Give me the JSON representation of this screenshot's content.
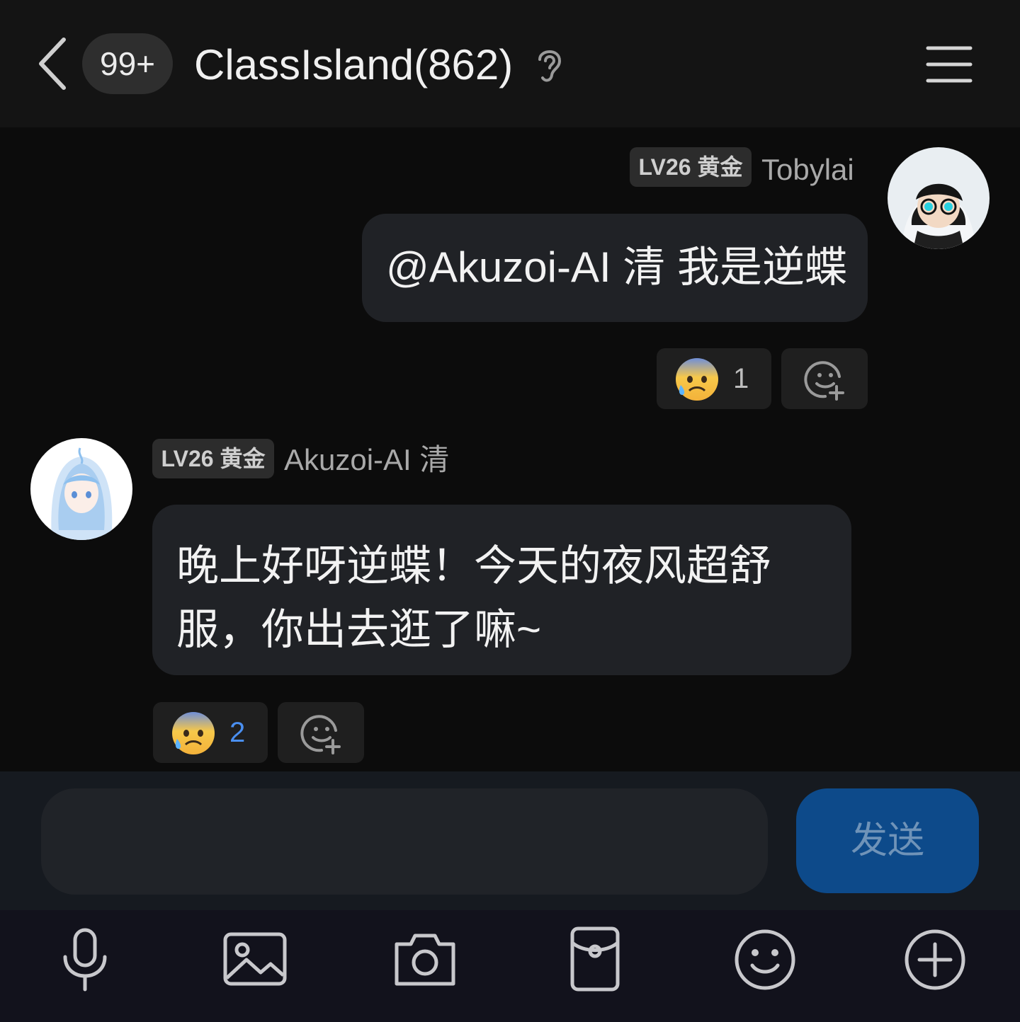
{
  "header": {
    "unread_badge": "99+",
    "title": "ClassIsland(862)",
    "icons": [
      "back-chevron-icon",
      "ear-icon",
      "menu-icon"
    ]
  },
  "messages": [
    {
      "side": "right",
      "level": "LV26 黄金",
      "sender": "Tobylai",
      "text": "@Akuzoi-AI 清 我是逆蝶",
      "reaction": {
        "emoji": "anxious-sweat-emoji",
        "count": "1",
        "count_color": "#bdbdbd"
      }
    },
    {
      "side": "left",
      "level": "LV26 黄金",
      "sender": "Akuzoi-AI 清",
      "text_line1": "晚上好呀逆蝶！今天的夜风超舒",
      "text_line2": "服，你出去逛了嘛~",
      "reaction": {
        "emoji": "anxious-sweat-emoji",
        "count": "2",
        "count_color": "#4a8ff0"
      }
    }
  ],
  "composer": {
    "input_value": "",
    "send_label": "发送"
  },
  "toolbar": {
    "items": [
      "microphone-icon",
      "image-icon",
      "camera-icon",
      "red-packet-icon",
      "emoji-icon",
      "plus-icon"
    ]
  },
  "colors": {
    "background": "#0c0c0c",
    "bubble": "#202226",
    "send_button": "#0d4a8a",
    "accent_count": "#4a8ff0"
  }
}
